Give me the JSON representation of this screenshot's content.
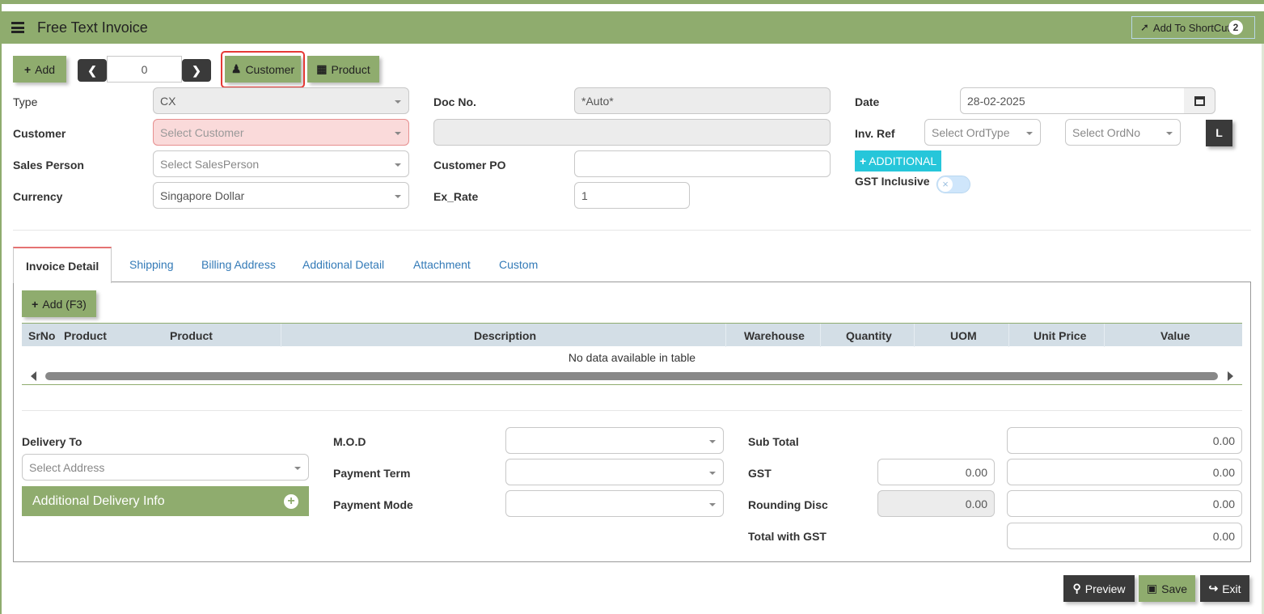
{
  "header": {
    "title": "Free Text Invoice",
    "shortcut_label": "Add To ShortCut",
    "shortcut_badge": "2"
  },
  "toolbar": {
    "add_label": "Add",
    "record_index": "0",
    "customer_label": "Customer",
    "product_label": "Product"
  },
  "form": {
    "type_label": "Type",
    "type_value": "CX",
    "customer_label": "Customer",
    "customer_placeholder": "Select Customer",
    "sales_person_label": "Sales Person",
    "sales_person_placeholder": "Select SalesPerson",
    "currency_label": "Currency",
    "currency_value": "Singapore Dollar",
    "doc_no_label": "Doc No.",
    "doc_no_value": "*Auto*",
    "customer_po_label": "Customer PO",
    "ex_rate_label": "Ex_Rate",
    "ex_rate_value": "1",
    "date_label": "Date",
    "date_value": "28-02-2025",
    "inv_ref_label": "Inv. Ref",
    "ord_type_placeholder": "Select OrdType",
    "ord_no_placeholder": "Select OrdNo",
    "l_button": "L",
    "additional_label": "ADDITIONAL",
    "gst_inclusive_label": "GST Inclusive"
  },
  "tabs": [
    {
      "label": "Invoice Detail"
    },
    {
      "label": "Shipping"
    },
    {
      "label": "Billing Address"
    },
    {
      "label": "Additional Detail"
    },
    {
      "label": "Attachment"
    },
    {
      "label": "Custom"
    }
  ],
  "detail": {
    "add_label": "Add (F3)",
    "columns": [
      "SrNo",
      "Product",
      "Product",
      "Description",
      "Warehouse",
      "Quantity",
      "UOM",
      "Unit Price",
      "Value"
    ],
    "empty_text": "No data available in table"
  },
  "footer": {
    "delivery_to_label": "Delivery To",
    "address_placeholder": "Select Address",
    "additional_delivery_label": "Additional Delivery Info",
    "mod_label": "M.O.D",
    "payment_term_label": "Payment Term",
    "payment_mode_label": "Payment Mode",
    "sub_total_label": "Sub Total",
    "sub_total_value": "0.00",
    "gst_label": "GST",
    "gst_rate_value": "0.00",
    "gst_value": "0.00",
    "rounding_label": "Rounding Disc",
    "rounding_rate_value": "0.00",
    "rounding_value": "0.00",
    "total_label": "Total with GST",
    "total_value": "0.00"
  },
  "actions": {
    "preview_label": "Preview",
    "save_label": "Save",
    "exit_label": "Exit"
  },
  "colors": {
    "brand_green": "#8fac6e",
    "dark_button": "#3a3a3a",
    "additional_cyan": "#26c6da",
    "error_bg": "#fadada",
    "highlight_red": "#e53935"
  }
}
